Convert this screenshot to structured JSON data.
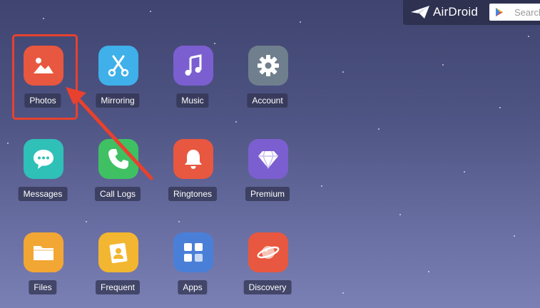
{
  "header": {
    "brand": "AirDroid",
    "search_placeholder": "Search"
  },
  "apps": [
    {
      "label": "Photos",
      "icon": "photos-icon",
      "color": "#e8573f"
    },
    {
      "label": "Mirroring",
      "icon": "scissors-icon",
      "color": "#3fb0ea"
    },
    {
      "label": "Music",
      "icon": "music-note-icon",
      "color": "#7b5fd0"
    },
    {
      "label": "Account",
      "icon": "gear-icon",
      "color": "#6f7f8d"
    },
    {
      "label": "Messages",
      "icon": "chat-bubble-icon",
      "color": "#2fc0b8"
    },
    {
      "label": "Call Logs",
      "icon": "phone-icon",
      "color": "#3fc163"
    },
    {
      "label": "Ringtones",
      "icon": "bell-icon",
      "color": "#e8573f"
    },
    {
      "label": "Premium",
      "icon": "diamond-icon",
      "color": "#7b5fd0"
    },
    {
      "label": "Files",
      "icon": "folder-icon",
      "color": "#f2a634"
    },
    {
      "label": "Frequent",
      "icon": "contact-card-icon",
      "color": "#f2b630"
    },
    {
      "label": "Apps",
      "icon": "apps-grid-icon",
      "color": "#4a7fd8"
    },
    {
      "label": "Discovery",
      "icon": "planet-icon",
      "color": "#e8573f"
    }
  ],
  "annotation": {
    "highlight_color": "#e8412e"
  }
}
